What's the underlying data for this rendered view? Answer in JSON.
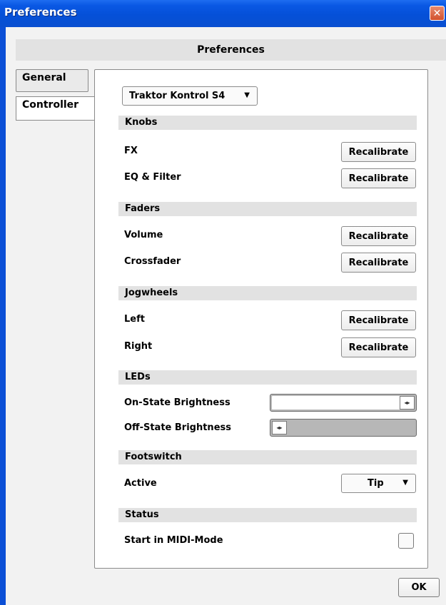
{
  "window": {
    "title": "Preferences",
    "close_symbol": "✕"
  },
  "header": {
    "title": "Preferences"
  },
  "tabs": [
    {
      "label": "General"
    },
    {
      "label": "Controller"
    }
  ],
  "controller": {
    "device": "Traktor Kontrol S4",
    "sections": {
      "knobs": "Knobs",
      "faders": "Faders",
      "jogwheels": "Jogwheels",
      "leds": "LEDs",
      "footswitch": "Footswitch",
      "status": "Status"
    },
    "rows": {
      "fx": "FX",
      "eq_filter": "EQ & Filter",
      "volume": "Volume",
      "crossfader": "Crossfader",
      "left": "Left",
      "right": "Right",
      "on_state": "On-State Brightness",
      "off_state": "Off-State Brightness",
      "active": "Active",
      "midi_mode": "Start in MIDI-Mode"
    },
    "recalibrate_label": "Recalibrate",
    "on_state_brightness": 1.0,
    "off_state_brightness": 0.0,
    "footswitch_active": "Tip",
    "midi_mode_checked": false
  },
  "ok_label": "OK",
  "icons": {
    "dropdown": "chevron-down-icon",
    "slider_handle": "left-right-arrows-icon"
  }
}
